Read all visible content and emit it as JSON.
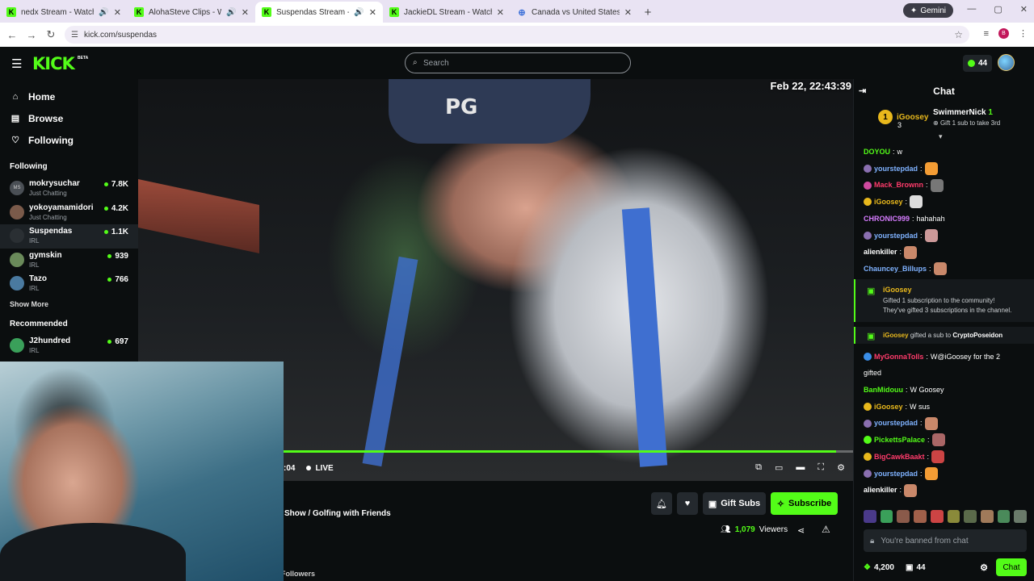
{
  "browser": {
    "tabs": [
      {
        "title": "nedx Stream - Watch Live o",
        "audio": true,
        "active": false
      },
      {
        "title": "AlohaSteve Clips - Watch Li",
        "audio": true,
        "active": false
      },
      {
        "title": "Suspendas Stream - Watch",
        "audio": true,
        "active": true
      },
      {
        "title": "JackieDL Stream - Watch Live o",
        "audio": false,
        "active": false
      },
      {
        "title": "Canada vs United States of Am",
        "audio": false,
        "active": false
      }
    ],
    "gemini_label": "Gemini",
    "url": "kick.com/suspendas",
    "profile_initial": "B"
  },
  "kick": {
    "logo": "KICK",
    "beta": "BETA",
    "search_placeholder": "Search",
    "points": "44"
  },
  "sidebar": {
    "nav": [
      {
        "label": "Home",
        "icon": "home-icon"
      },
      {
        "label": "Browse",
        "icon": "browse-icon"
      },
      {
        "label": "Following",
        "icon": "heart-icon"
      }
    ],
    "following_header": "Following",
    "following": [
      {
        "name": "mokrysuchar",
        "category": "Just Chatting",
        "viewers": "7.8K",
        "avatar": "MS"
      },
      {
        "name": "yokoyamamidori",
        "category": "Just Chatting",
        "viewers": "4.2K",
        "avatar": ""
      },
      {
        "name": "Suspendas",
        "category": "IRL",
        "viewers": "1.1K",
        "avatar": "",
        "active": true
      },
      {
        "name": "gymskin",
        "category": "IRL",
        "viewers": "939",
        "avatar": ""
      },
      {
        "name": "Tazo",
        "category": "IRL",
        "viewers": "766",
        "avatar": ""
      }
    ],
    "show_more": "Show More",
    "recommended_header": "Recommended",
    "recommended": [
      {
        "name": "J2hundred",
        "category": "IRL",
        "viewers": "697"
      }
    ]
  },
  "player": {
    "timestamp": "Feb 22, 22:43:39",
    "time": ":04",
    "live_label": "LIVE",
    "progress": 0.97
  },
  "stream": {
    "title": "Show / Golfing with Friends",
    "gift_subs_label": "Gift Subs",
    "subscribe_label": "Subscribe",
    "viewers_count": "1,079",
    "viewers_label": "Viewers",
    "followers_label": "Followers"
  },
  "chat": {
    "title": "Chat",
    "leaderboard": {
      "first_rank": "1",
      "first_name": "iGoosey",
      "first_count": "3",
      "second_name": "SwimmerNick",
      "second_count": "1",
      "second_sub": "Gift 1 sub to take 3rd"
    },
    "messages": [
      {
        "user": "DOYOU",
        "text": "w",
        "color": "#53fc18",
        "badge": "",
        "emote": ""
      },
      {
        "user": "yourstepdad",
        "text": "",
        "color": "#7fb2ff",
        "badge": "#8a6fb0",
        "emote": "#f39c34"
      },
      {
        "user": "Mack_Brownn",
        "text": "",
        "color": "#ff3b6b",
        "badge": "#d04aa0",
        "emote": "#777"
      },
      {
        "user": "iGoosey",
        "text": "",
        "color": "#e8b81c",
        "badge": "#e8b81c",
        "emote": "#ddd"
      },
      {
        "user": "CHRONIC999",
        "text": "hahahah",
        "color": "#d67cff",
        "badge": "",
        "emote": ""
      },
      {
        "user": "yourstepdad",
        "text": "",
        "color": "#7fb2ff",
        "badge": "#8a6fb0",
        "emote": "#c99"
      },
      {
        "user": "alienkiller",
        "text": "",
        "color": "#ffffff",
        "badge": "",
        "emote": "#c9886a"
      },
      {
        "user": "Chauncey_Billups",
        "text": "",
        "color": "#7fb2ff",
        "badge": "",
        "emote": "#c9886a"
      }
    ],
    "event1": {
      "name": "iGoosey",
      "line1": "Gifted 1 subscription to the community!",
      "line2": "They've gifted 3 subscriptions in the channel."
    },
    "event2": {
      "giver": "iGoosey",
      "mid": "gifted a sub to",
      "receiver": "CryptoPoseidon"
    },
    "messages2": [
      {
        "user": "MyGonnaTolls",
        "text": "W@iGoosey for the 2",
        "color": "#ff3b6b",
        "badge": "#3a8ee8",
        "emote": ""
      },
      {
        "user": "",
        "text": "gifted",
        "color": "#fff",
        "badge": "",
        "emote": ""
      },
      {
        "user": "BanMidouu",
        "text": "W Goosey",
        "color": "#53fc18",
        "badge": "",
        "emote": ""
      },
      {
        "user": "iGoosey",
        "text": "W sus",
        "color": "#e8b81c",
        "badge": "#e8b81c",
        "emote": ""
      },
      {
        "user": "yourstepdad",
        "text": "",
        "color": "#7fb2ff",
        "badge": "#8a6fb0",
        "emote": "#c9886a"
      },
      {
        "user": "PickettsPalace",
        "text": "",
        "color": "#53fc18",
        "badge": "#53fc18",
        "emote": "#a66"
      },
      {
        "user": "BigCawkBaakt",
        "text": "",
        "color": "#ff3b6b",
        "badge": "#e8b81c",
        "emote": "#c44"
      },
      {
        "user": "yourstepdad",
        "text": "",
        "color": "#7fb2ff",
        "badge": "#8a6fb0",
        "emote": "#f39c34"
      },
      {
        "user": "alienkiller",
        "text": "",
        "color": "#ffffff",
        "badge": "",
        "emote": "#c9886a"
      }
    ],
    "banned_text": "You're banned from chat",
    "points": "4,200",
    "sub_count": "44",
    "chat_button": "Chat"
  }
}
